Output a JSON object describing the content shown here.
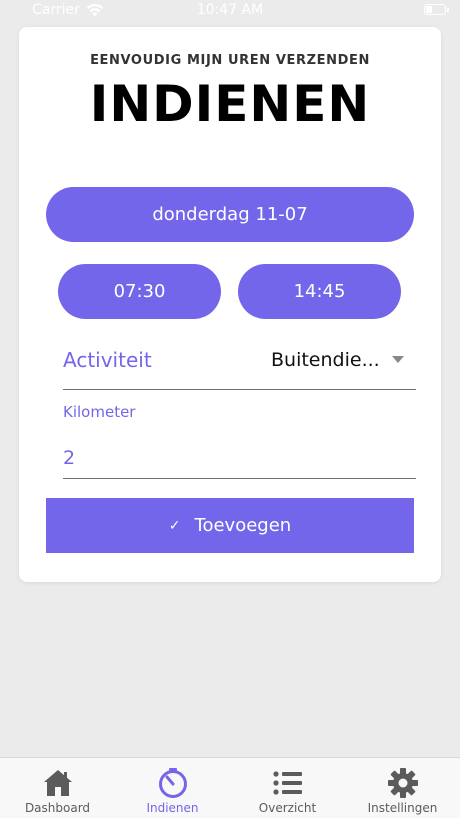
{
  "status_bar": {
    "carrier": "Carrier",
    "time": "10:47 AM"
  },
  "header": {
    "subtitle": "EENVOUDIG MIJN UREN VERZENDEN",
    "title": "INDIENEN"
  },
  "form": {
    "date": "donderdag 11-07",
    "start_time": "07:30",
    "end_time": "14:45",
    "activity_label": "Activiteit",
    "activity_value": "Buitendie...",
    "km_label": "Kilometer",
    "km_value": "2",
    "submit_label": "Toevoegen"
  },
  "tabbar": {
    "tabs": [
      {
        "label": "Dashboard",
        "icon": "home-icon",
        "active": false
      },
      {
        "label": "Indienen",
        "icon": "timer-icon",
        "active": true
      },
      {
        "label": "Overzicht",
        "icon": "list-icon",
        "active": false
      },
      {
        "label": "Instellingen",
        "icon": "gear-icon",
        "active": false
      }
    ]
  },
  "colors": {
    "accent": "#7366ea",
    "background": "#ebebeb",
    "tab_inactive": "#5b5b5b"
  }
}
